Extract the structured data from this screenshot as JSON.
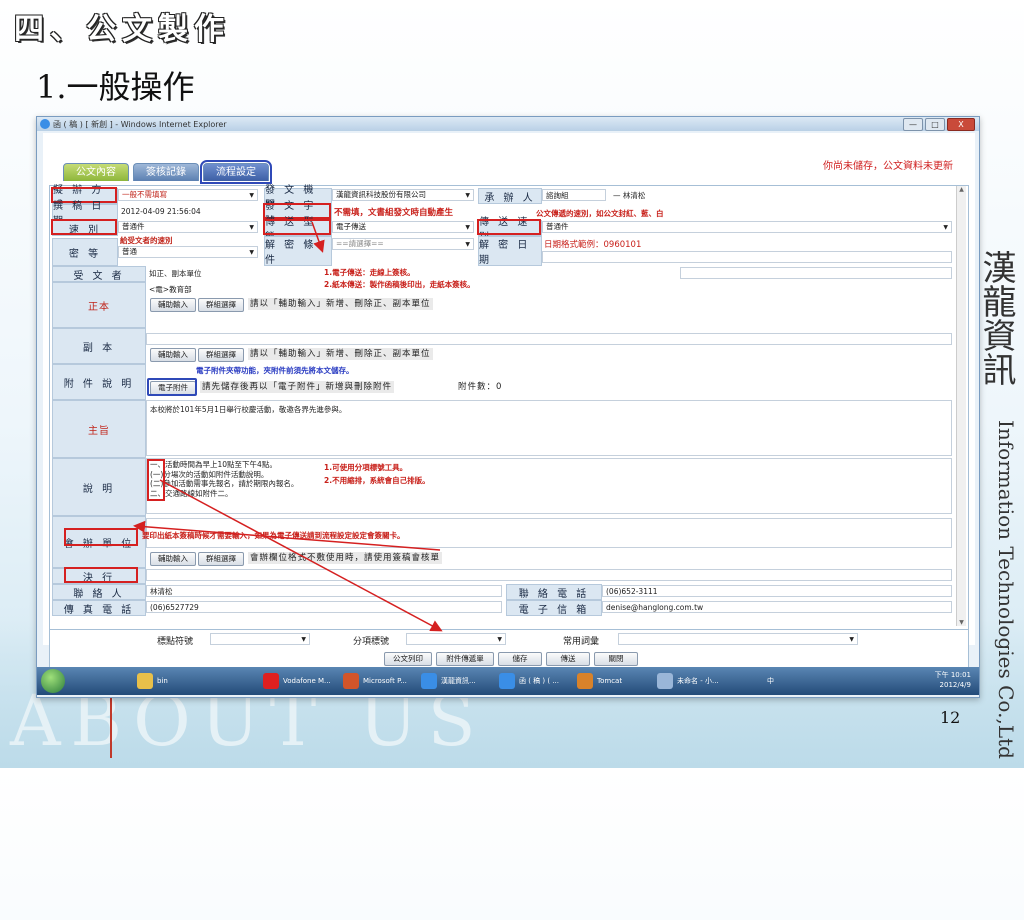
{
  "slide": {
    "heading": "四、公文製作",
    "subheading": "1.一般操作",
    "page_number": "12",
    "side_text": "Information Technologies Co.,Ltd",
    "side_cjk": "漢龍資訊",
    "watermark": "ABOUT US"
  },
  "window": {
    "title": "函 ( 稿 ) [ 新創 ] - Windows Internet Explorer",
    "minimize": "—",
    "maximize": "□",
    "close": "X"
  },
  "tabs": [
    {
      "label": "公文內容"
    },
    {
      "label": "簽核記錄"
    },
    {
      "label": "流程設定"
    }
  ],
  "notice": "你尚未儲存，公文資料未更新",
  "form": {
    "send_method": {
      "label": "擬 辦 方 式",
      "value": "一般不需填寫"
    },
    "issuing_agency": {
      "label": "發 文 機 關",
      "value": "漢龍資訊科技股份有限公司"
    },
    "handler": {
      "label": "承 辦 人",
      "value": "諮詢組",
      "value2": "—  林清松"
    },
    "draft_date": {
      "label": "撰 稿 日 期",
      "value": "2012-04-09 21:56:04"
    },
    "doc_number": {
      "label": "發 文 字 號",
      "value": "不需填，文書組發文時自動產生"
    },
    "speed": {
      "label": "速 別",
      "value": "普通件"
    },
    "transfer_type": {
      "label": "傳 送 型 態",
      "value": "電子傳送"
    },
    "transfer_speed": {
      "label": "傳 送 速 別",
      "value": "普通件"
    },
    "security": {
      "label": "密 等",
      "value": "普通"
    },
    "declass_cond": {
      "label": "解 密 條 件",
      "value": "==請選擇=="
    },
    "declass_date": {
      "label": "解 密 日 期",
      "value": "日期格式範例：0960101"
    },
    "recipient": {
      "label": "受 文 者",
      "value": "如正、副本單位"
    },
    "main_copy": {
      "label": "正本",
      "value": "<電>教育部"
    },
    "cc": {
      "label": "副 本"
    },
    "attachment": {
      "label": "附 件 說 明",
      "button": "電子附件",
      "hint": "請先儲存後再以「電子附件」新增與刪除附件",
      "count": "附件數：0"
    },
    "subject": {
      "label": "主旨",
      "value": "本校將於101年5月1日舉行校慶活動，敬邀各界先進參與。"
    },
    "description": {
      "label": "說 明",
      "lines": [
        "一、活動時間為早上10點至下午4點。",
        "(一)分場次的活動如附件活動說明。",
        "(二)參加活動需事先報名，請於期限內報名。",
        "二、交通路線如附件二。"
      ]
    },
    "cosign": {
      "label": "會 辦 單 位",
      "hint": "會辦欄位格式不敷使用時，請使用簽稿會核單"
    },
    "decision": {
      "label": "決 行"
    },
    "contact": {
      "label": "聯 絡 人",
      "value": "林清松"
    },
    "phone": {
      "label": "聯 絡 電 話",
      "value": "(06)652-3111"
    },
    "fax": {
      "label": "傳 真 電 話",
      "value": "(06)6527729"
    },
    "email": {
      "label": "電 子 信 箱",
      "value": "denise@hanglong.com.tw"
    },
    "assist_btn": "輔助輸入",
    "group_btn": "群組選擇",
    "unit_hint": "請以「輔助輸入」新增、刪除正、副本單位"
  },
  "notes": {
    "speed_note": "給受文者的速別",
    "transfer_speed_note": "公文傳遞的速別，如公文封紅、藍、白",
    "transfer_note_1": "1.電子傳送：走線上簽核。",
    "transfer_note_2": "2.紙本傳送：製作函稿後印出，走紙本簽核。",
    "attach_note": "電子附件夾帶功能，夾附件前須先將本文儲存。",
    "desc_note_1": "1.可使用分項標號工具。",
    "desc_note_2": "2.不用縮排，系統會自己排版。",
    "cosign_note": "要印出紙本簽稿時候才需要輸入，如果為電子傳送請到流程設定設定會簽關卡。"
  },
  "bottom": {
    "label_num": "標點符號",
    "label_item": "分項標號",
    "label_common": "常用詞彙",
    "buttons": [
      "公文列印",
      "附件傳遞單",
      "儲存",
      "傳送",
      "關閉"
    ]
  },
  "taskbar": {
    "items": [
      "bin",
      "Vodafone M...",
      "Microsoft P...",
      "漢龍資訊...",
      "函 ( 稿 ) ( ...",
      "Tomcat",
      "未命名 - 小..."
    ],
    "time": "下午 10:01",
    "date": "2012/4/9",
    "tray": "中"
  }
}
